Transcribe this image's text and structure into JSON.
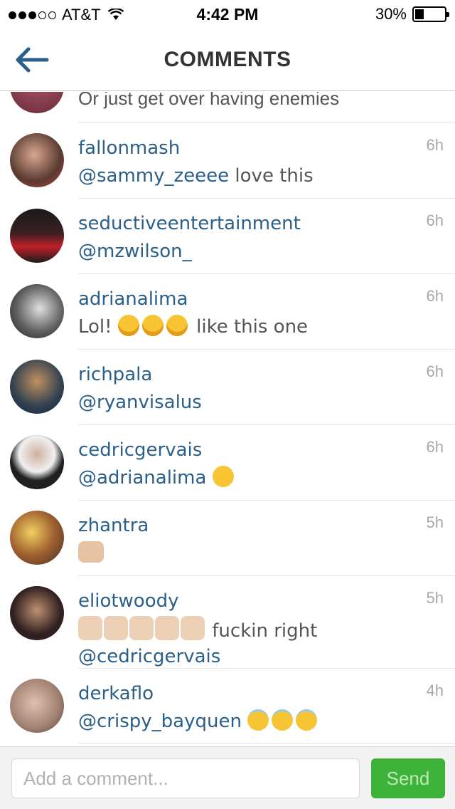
{
  "status_bar": {
    "carrier": "AT&T",
    "time": "4:42 PM",
    "battery": "30%",
    "signal_bars": 3,
    "battery_level": 0.3
  },
  "nav": {
    "title": "COMMENTS",
    "back_icon": "back-arrow-icon"
  },
  "partial_comment": {
    "text": "Or just get over having enemies"
  },
  "comments": [
    {
      "username": "fallonmash",
      "mention": "@sammy_zeeee",
      "text": " love this",
      "time": "6h"
    },
    {
      "username": "seductiveentertainment",
      "mention": "@mzwilson_",
      "text": "",
      "time": "6h"
    },
    {
      "username": "adrianalima",
      "mention": "",
      "text": "Lol!",
      "suffix": " like this one",
      "time": "6h"
    },
    {
      "username": "richpala",
      "mention": "@ryanvisalus",
      "text": "",
      "time": "6h"
    },
    {
      "username": "cedricgervais",
      "mention": "@adrianalima",
      "text": "",
      "time": "6h"
    },
    {
      "username": "zhantra",
      "mention": "",
      "text": "",
      "time": "5h"
    },
    {
      "username": "eliotwoody",
      "mention": "@cedricgervais",
      "text": " fuckin right",
      "time": "5h"
    },
    {
      "username": "derkaflo",
      "mention": "@crispy_bayquen",
      "text": "",
      "time": "4h"
    }
  ],
  "composer": {
    "placeholder": "Add a comment...",
    "send_label": "Send"
  },
  "colors": {
    "username": "#2a5f8a",
    "send_button": "#3eb33a",
    "nav_back_arrow": "#2a5f8a"
  }
}
